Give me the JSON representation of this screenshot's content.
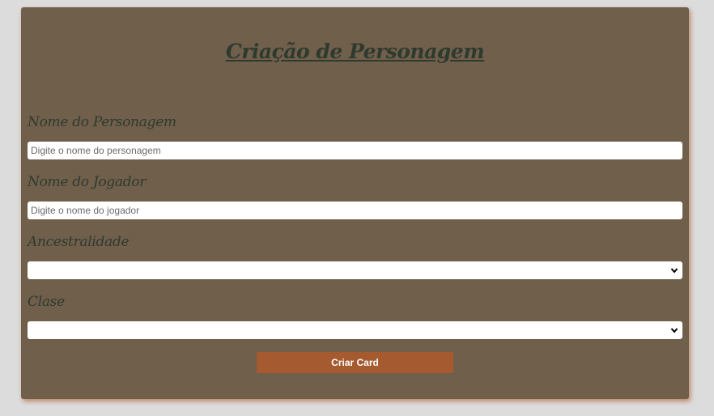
{
  "form": {
    "title": "Criação de Personagem",
    "character_name_label": "Nome do Personagem",
    "character_name_placeholder": "Digite o nome do personagem",
    "player_name_label": "Nome do Jogador",
    "player_name_placeholder": "Digite o nome do jogador",
    "ancestry_label": "Ancestralidade",
    "ancestry_value": "",
    "class_label": "Clase",
    "class_value": "",
    "submit_label": "Criar Card"
  },
  "colors": {
    "page_bg": "#dcdcdc",
    "card_bg": "#705f4b",
    "heading_text": "#2f3a2f",
    "button_bg": "#a55a2f",
    "button_text": "#ffffff"
  },
  "icons": {
    "select_arrow": "chevron-down-icon"
  }
}
